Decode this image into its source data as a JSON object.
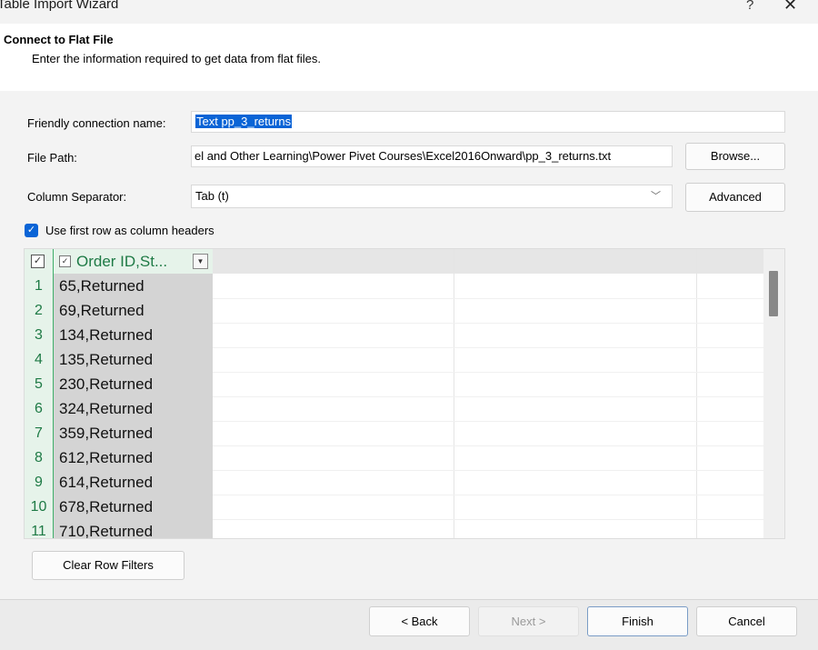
{
  "window": {
    "title": "Table Import Wizard",
    "help": "?",
    "close": "✕"
  },
  "header": {
    "title": "Connect to Flat File",
    "subtitle": "Enter the information required to get data from flat files."
  },
  "form": {
    "friendly_label": "Friendly connection name:",
    "friendly_value": "Text pp_3_returns",
    "filepath_label": "File Path:",
    "filepath_value": "el and Other Learning\\Power Pivet Courses\\Excel2016Onward\\pp_3_returns.txt",
    "browse_label": "Browse...",
    "separator_label": "Column Separator:",
    "separator_value": "Tab (t)",
    "advanced_label": "Advanced",
    "use_first_row_label": "Use first row as column headers"
  },
  "grid": {
    "column_header": "Order ID,St...",
    "rows": [
      {
        "num": "1",
        "value": "65,Returned"
      },
      {
        "num": "2",
        "value": "69,Returned"
      },
      {
        "num": "3",
        "value": "134,Returned"
      },
      {
        "num": "4",
        "value": "135,Returned"
      },
      {
        "num": "5",
        "value": "230,Returned"
      },
      {
        "num": "6",
        "value": "324,Returned"
      },
      {
        "num": "7",
        "value": "359,Returned"
      },
      {
        "num": "8",
        "value": "612,Returned"
      },
      {
        "num": "9",
        "value": "614,Returned"
      },
      {
        "num": "10",
        "value": "678,Returned"
      },
      {
        "num": "11",
        "value": "710,Returned"
      }
    ]
  },
  "buttons": {
    "clear_filters": "Clear Row Filters",
    "back": "< Back",
    "next": "Next >",
    "finish": "Finish",
    "cancel": "Cancel"
  },
  "colors": {
    "accent": "#0a64d6",
    "row_number_green": "#1e7a45"
  }
}
